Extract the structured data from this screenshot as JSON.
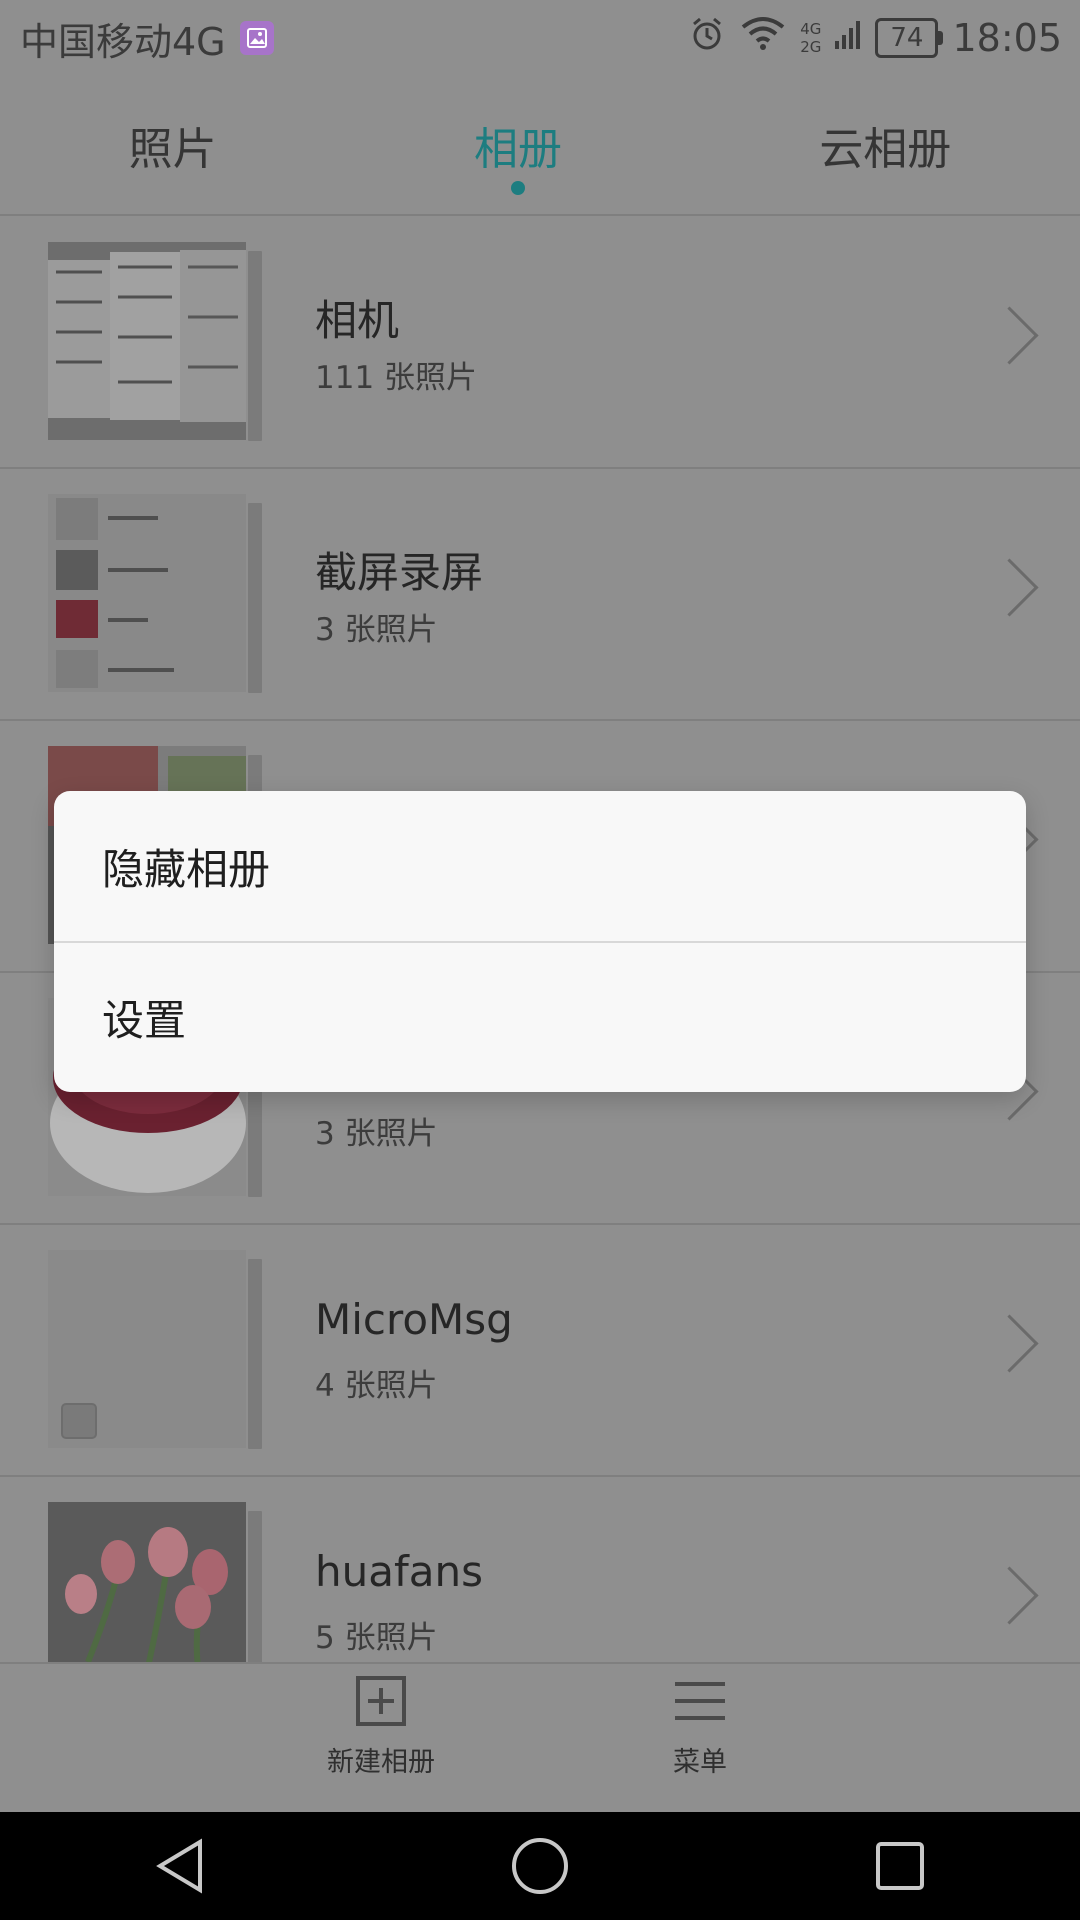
{
  "status_bar": {
    "carrier": "中国移动4G",
    "signal_labels": [
      "4G",
      "2G"
    ],
    "battery": "74",
    "time": "18:05"
  },
  "tabs": [
    {
      "label": "照片",
      "active": false
    },
    {
      "label": "相册",
      "active": true
    },
    {
      "label": "云相册",
      "active": false
    }
  ],
  "albums": [
    {
      "name": "相机",
      "count": "111 张照片"
    },
    {
      "name": "截屏录屏",
      "count": "3 张照片"
    },
    {
      "name": "",
      "count": ""
    },
    {
      "name": "",
      "count": "3 张照片"
    },
    {
      "name": "MicroMsg",
      "count": "4 张照片"
    },
    {
      "name": "huafans",
      "count": "5 张照片"
    }
  ],
  "popup_menu": {
    "items": [
      "隐藏相册",
      "设置"
    ]
  },
  "bottom_bar": {
    "new_album_label": "新建相册",
    "menu_label": "菜单"
  },
  "colors": {
    "accent": "#1d7d80",
    "dimmed_background": "#8f8f8f",
    "popup_background": "#f8f8f8"
  }
}
